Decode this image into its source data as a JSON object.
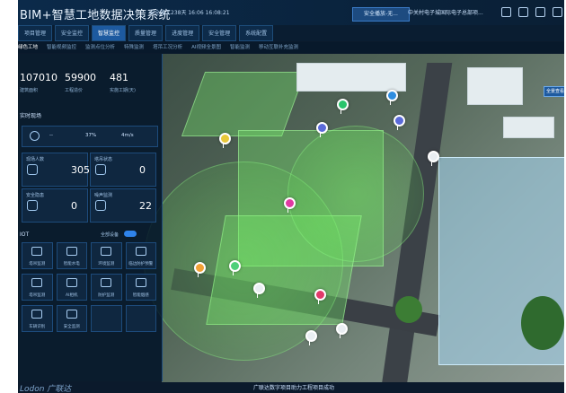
{
  "header": {
    "title": "BIM+智慧工地数据决策系统",
    "datetime": "安全施工238天  16:06 16:08:21",
    "notice_button": "安全播放-无...",
    "org": "中关村电子城国际电子总部项...",
    "icons": [
      "grid-icon",
      "monitor-icon",
      "doc-icon",
      "download-icon",
      "settings-icon"
    ]
  },
  "nav": {
    "tabs": [
      {
        "label": "项目管理",
        "active": false
      },
      {
        "label": "安全监控",
        "active": false
      },
      {
        "label": "智慧监控",
        "active": true
      },
      {
        "label": "质量管理",
        "active": false
      },
      {
        "label": "进度管理",
        "active": false
      },
      {
        "label": "安全管理",
        "active": false
      },
      {
        "label": "系统配置",
        "active": false
      }
    ],
    "subtabs": [
      {
        "label": "绿色工地",
        "active": true
      },
      {
        "label": "智能视频监控",
        "active": false
      },
      {
        "label": "监测点位分析",
        "active": false
      },
      {
        "label": "特殊监测",
        "active": false
      },
      {
        "label": "塔吊工况分析",
        "active": false
      },
      {
        "label": "AI视频全景图",
        "active": false
      },
      {
        "label": "智能监测",
        "active": false
      },
      {
        "label": "移动互联补充监测",
        "active": false
      }
    ]
  },
  "sidebar": {
    "kpis": [
      {
        "value": "107010",
        "label": "建筑面积"
      },
      {
        "value": "59900",
        "label": "工程造价"
      },
      {
        "value": "481",
        "label": "实施工期(天)"
      }
    ],
    "section_env": "实时现场",
    "weather": {
      "temp": "--",
      "humidity": "37%",
      "wind": "4m/s"
    },
    "cards": [
      {
        "title": "现场人数",
        "value": "305",
        "icon": "person-icon"
      },
      {
        "title": "塔吊状态",
        "value": "0",
        "icon": "tower-icon"
      },
      {
        "title": "安全隐患",
        "value": "0",
        "icon": "shield-icon"
      },
      {
        "title": "噪声监测",
        "value": "22",
        "icon": "sound-icon"
      }
    ],
    "section_iot": "IOT",
    "iot_toggle": "全部设备",
    "iot_items": [
      {
        "label": "塔吊监测",
        "icon": "crane-icon"
      },
      {
        "label": "智能水电",
        "icon": "water-icon"
      },
      {
        "label": "环境监测",
        "icon": "env-icon"
      },
      {
        "label": "临边防护预警",
        "icon": "fence-icon"
      },
      {
        "label": "塔吊监测",
        "icon": "crane-icon"
      },
      {
        "label": "AI相机",
        "icon": "camera-icon"
      },
      {
        "label": "防护监测",
        "icon": "guard-icon"
      },
      {
        "label": "智能烟感",
        "icon": "smoke-icon"
      },
      {
        "label": "车辆识别",
        "icon": "car-icon"
      },
      {
        "label": "安全监测",
        "icon": "alert-icon"
      },
      {
        "label": "",
        "icon": ""
      },
      {
        "label": "",
        "icon": ""
      }
    ]
  },
  "scene": {
    "floating_button": "全景查看"
  },
  "footer": {
    "brand": "Lodon 广联达",
    "status": "广联达数字项目助力工程项目成功"
  },
  "colors": {
    "accent": "#1d5aa0",
    "panel": "#0f2740",
    "border": "#1d4b7b"
  }
}
